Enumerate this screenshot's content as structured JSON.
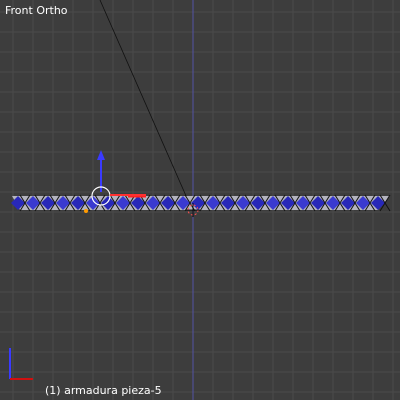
{
  "viewport": {
    "view_name": "Front Ortho",
    "object_info": "(1) armadura pieza-5"
  },
  "colors": {
    "background": "#3d3d3d",
    "grid": "#4a4a4a",
    "axis_z": "#5a5aff",
    "axis_x": "#ff3030",
    "gizmo_z": "#3a3aff",
    "mesh_blue": "#2828b8",
    "mesh_light": "#b4b4c0"
  },
  "icons": [
    "transform-gizmo-icon",
    "cursor-3d-icon",
    "object-origin-icon",
    "axis-orientation-icon"
  ]
}
